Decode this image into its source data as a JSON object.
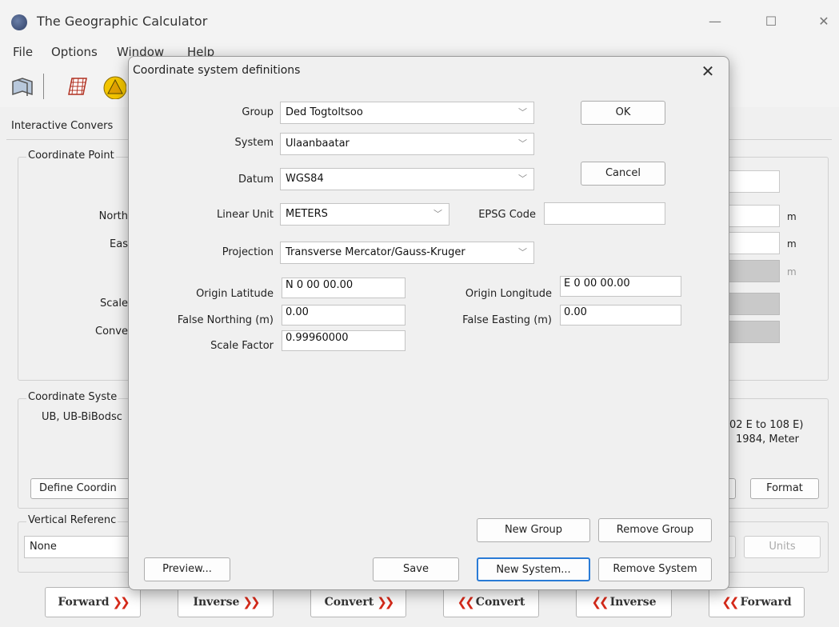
{
  "app": {
    "title": "The Geographic Calculator",
    "minimize_glyph": "—",
    "maximize_glyph": "☐",
    "close_glyph": "✕"
  },
  "menu": [
    "File",
    "Options",
    "Window",
    "Help"
  ],
  "main": {
    "tab_label": "Interactive Convers",
    "coord_point_title": "Coordinate Point",
    "labels": {
      "north": "North",
      "east": "Eas",
      "scale": "Scale",
      "conv": "Conve"
    },
    "units": {
      "m1": "m",
      "m2": "m",
      "m3": "m"
    },
    "coord_system_title": "Coordinate Syste",
    "coord_system_desc": "UB, UB-BiBodsc",
    "right_desc_1": "02 E to 108 E)",
    "right_desc_2": "1984, Meter",
    "define_button": "Define Coordin",
    "format_button": "Format",
    "vertical_title": "Vertical Referenc",
    "vertical_value": "None",
    "units_button": "Units"
  },
  "nav": [
    {
      "label": "Forward",
      "arrows": "❯❯",
      "dir": "right"
    },
    {
      "label": "Inverse",
      "arrows": "❯❯",
      "dir": "right"
    },
    {
      "label": "Convert",
      "arrows": "❯❯",
      "dir": "right"
    },
    {
      "label": "Convert",
      "arrows": "❮❮",
      "dir": "left"
    },
    {
      "label": "Inverse",
      "arrows": "❮❮",
      "dir": "left"
    },
    {
      "label": "Forward",
      "arrows": "❮❮",
      "dir": "left"
    }
  ],
  "dialog": {
    "title": "Coordinate system definitions",
    "close_glyph": "✕",
    "group_label": "Group",
    "group_value": "Ded Togtoltsoo",
    "system_label": "System",
    "system_value": "Ulaanbaatar",
    "datum_label": "Datum",
    "datum_value": "WGS84",
    "linear_unit_label": "Linear Unit",
    "linear_unit_value": "METERS",
    "epsg_label": "EPSG Code",
    "epsg_value": "",
    "projection_label": "Projection",
    "projection_value": "Transverse Mercator/Gauss-Kruger",
    "origin_lat_label": "Origin Latitude",
    "origin_lat_value": "N 0 00 00.00",
    "origin_lon_label": "Origin Longitude",
    "origin_lon_value": "E 0 00 00.00",
    "false_northing_label": "False Northing (m)",
    "false_northing_value": "0.00",
    "false_easting_label": "False Easting (m)",
    "false_easting_value": "0.00",
    "scale_factor_label": "Scale Factor",
    "scale_factor_value": "0.99960000",
    "ok_button": "OK",
    "cancel_button": "Cancel",
    "new_group_button": "New Group",
    "remove_group_button": "Remove Group",
    "preview_button": "Preview...",
    "save_button": "Save",
    "new_system_button": "New System...",
    "remove_system_button": "Remove System"
  },
  "chevron_glyph": "﹀",
  "colors": {
    "accent_arrow": "#d62a1a",
    "focus_blue": "#2a7bd6"
  }
}
